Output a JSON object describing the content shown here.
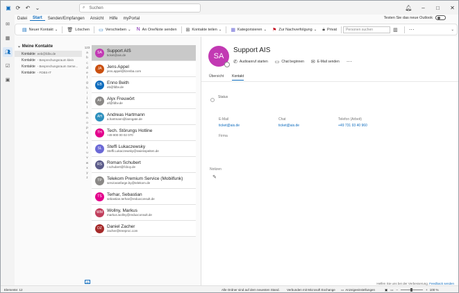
{
  "titlebar": {
    "search_placeholder": "Suchen"
  },
  "menu": {
    "items": [
      "Datei",
      "Start",
      "Senden/Empfangen",
      "Ansicht",
      "Hilfe",
      "myPortal"
    ],
    "active": "Start"
  },
  "new_outlook": {
    "label": "Testen Sie das neue Outlook"
  },
  "ribbon": {
    "new_contact": "Neuer Kontakt",
    "delete": "Löschen",
    "move": "Verschieben",
    "onenote": "An OneNote senden",
    "share": "Kontakte teilen",
    "categorize": "Kategorisieren",
    "followup": "Zur Nachverfolgung",
    "private": "Privat",
    "search_people_placeholder": "Personen suchen"
  },
  "folders": {
    "header": "Meine Kontakte",
    "items": [
      {
        "name": "Kontakte",
        "sub": "eeb@fdbv.de"
      },
      {
        "name": "Kontakte",
        "sub": "- Besprechungsraum klein"
      },
      {
        "name": "Kontakte",
        "sub": "- Besprechungsraum Seme..."
      },
      {
        "name": "Kontakte",
        "sub": "- FDBS-IT"
      }
    ]
  },
  "alpha_index": [
    "123",
    "a",
    "b",
    "c",
    "d",
    "e",
    "f",
    "g",
    "h",
    "i",
    "j",
    "k",
    "l",
    "m",
    "n",
    "o",
    "p",
    "q",
    "r",
    "s",
    "t",
    "u",
    "v",
    "w",
    "x",
    "y",
    "z"
  ],
  "contacts": [
    {
      "initials": "SA",
      "name": "Support AIS",
      "email": "ticket@ais.de",
      "color": "#c239b3"
    },
    {
      "initials": "JA",
      "name": "Jens Appel",
      "email": "jens.appel@lizenba.com",
      "color": "#ca5010"
    },
    {
      "initials": "EB",
      "name": "Enno Beith",
      "email": "eb@fdbv.de",
      "color": "#0f6cbd"
    },
    {
      "initials": "AF",
      "name": "Alyx Freuwört",
      "email": "af@fdbv.de",
      "color": "#8a8886"
    },
    {
      "initials": "AH",
      "name": "Andreas Hartmann",
      "email": "a.hartmann@lanngate.de",
      "color": "#2c8fbd"
    },
    {
      "initials": "TH",
      "name": "Tech. Störungs Hotline",
      "email": "+49 800 00 02 070",
      "color": "#e3008c"
    },
    {
      "initials": "SL",
      "name": "Steffi Lukaczewsky",
      "email": "Steffi.Lukaczewsky@swiesspeiten.de",
      "color": "#6b69d6"
    },
    {
      "initials": "RS",
      "name": "Roman Schubert",
      "email": "r.schubert@fcboy.de",
      "color": "#5c5c8a"
    },
    {
      "initials": "TP",
      "name": "Telekom Premium Service (Mobilfunk)",
      "email": "serviceanfarge.by@telekom.de",
      "color": "#8a8886"
    },
    {
      "initials": "TS",
      "name": "Terhar, Sebastian",
      "email": "sebastian.terhar@reduxconsult.de",
      "color": "#e3008c"
    },
    {
      "initials": "WM",
      "name": "Wollny, Markus",
      "email": "markus.wollny@reduxconsult.de",
      "color": "#c13e5c"
    },
    {
      "initials": "DZ",
      "name": "Daniel Zacher",
      "email": "zacher@treeproc.com",
      "color": "#a52a2a"
    }
  ],
  "detail": {
    "initials": "SA",
    "name": "Support AIS",
    "actions": {
      "call": "Audioanruf starten",
      "chat": "Chat beginnen",
      "mail": "E-Mail senden"
    },
    "tabs": [
      "Übersicht",
      "Kontakt"
    ],
    "active_tab": "Kontakt",
    "status_label": "Status",
    "email_label": "E-Mail",
    "email_value": "ticket@ais.de",
    "chat_label": "Chat",
    "chat_value": "ticket@ais.de",
    "phone_label": "Telefon (Arbeit)",
    "phone_value": "+49 731 93 40 960",
    "company_label": "Firma",
    "notes_label": "Notizen"
  },
  "feedback": {
    "text": "Helfen Sie uns bei der Verbesserung.",
    "link": "Feedback senden"
  },
  "statusbar": {
    "items": "Elemente: 12",
    "folders": "Alle Ordner sind auf dem neuesten Stand.",
    "connection": "Verbunden mit Microsoft Exchange",
    "display": "Anzeigeeinstellungen",
    "zoom": "100 %"
  }
}
